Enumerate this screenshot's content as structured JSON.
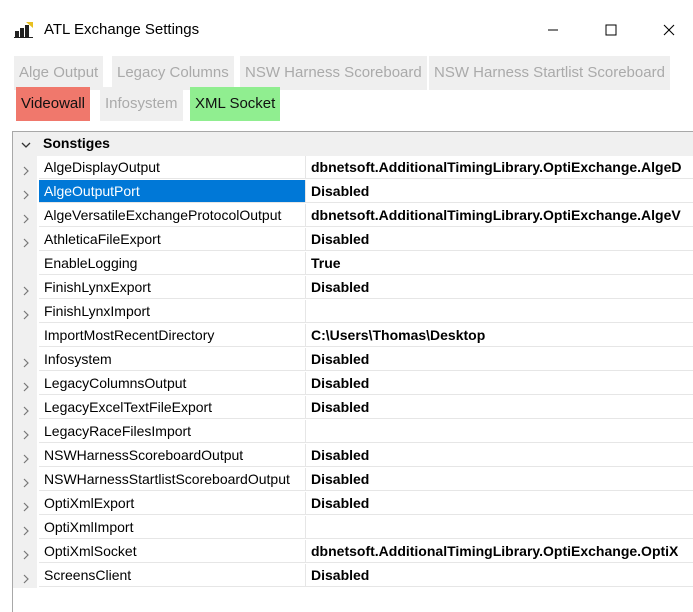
{
  "window": {
    "title": "ATL Exchange Settings",
    "controls": {
      "minimize_icon": "minimize-icon",
      "maximize_icon": "maximize-icon",
      "close_icon": "close-icon"
    }
  },
  "toolbar": {
    "buttons": [
      {
        "label": "Alge Output",
        "state": "disabled"
      },
      {
        "label": "Legacy Columns",
        "state": "disabled"
      },
      {
        "label": "NSW Harness Scoreboard",
        "state": "disabled"
      },
      {
        "label": "NSW Harness Startlist Scoreboard",
        "state": "disabled"
      },
      {
        "label": "Videowall",
        "state": "error",
        "color": "#f0786c"
      },
      {
        "label": "Infosystem",
        "state": "disabled"
      },
      {
        "label": "XML Socket",
        "state": "ok",
        "color": "#90ee90"
      }
    ]
  },
  "property_grid": {
    "category": "Sonstiges",
    "selected_color": "#0078d7",
    "rows": [
      {
        "name": "AlgeDisplayOutput",
        "value": "dbnetsoft.AdditionalTimingLibrary.OptiExchange.AlgeD",
        "expandable": true
      },
      {
        "name": "AlgeOutputPort",
        "value": "Disabled",
        "expandable": true,
        "selected": true
      },
      {
        "name": "AlgeVersatileExchangeProtocolOutput",
        "value": "dbnetsoft.AdditionalTimingLibrary.OptiExchange.AlgeV",
        "expandable": true
      },
      {
        "name": "AthleticaFileExport",
        "value": "Disabled",
        "expandable": true
      },
      {
        "name": "EnableLogging",
        "value": "True",
        "expandable": false
      },
      {
        "name": "FinishLynxExport",
        "value": "Disabled",
        "expandable": true
      },
      {
        "name": "FinishLynxImport",
        "value": "",
        "expandable": true
      },
      {
        "name": "ImportMostRecentDirectory",
        "value": "C:\\Users\\Thomas\\Desktop",
        "expandable": false
      },
      {
        "name": "Infosystem",
        "value": "Disabled",
        "expandable": true
      },
      {
        "name": "LegacyColumnsOutput",
        "value": "Disabled",
        "expandable": true
      },
      {
        "name": "LegacyExcelTextFileExport",
        "value": "Disabled",
        "expandable": true
      },
      {
        "name": "LegacyRaceFilesImport",
        "value": "",
        "expandable": true
      },
      {
        "name": "NSWHarnessScoreboardOutput",
        "value": "Disabled",
        "expandable": true
      },
      {
        "name": "NSWHarnessStartlistScoreboardOutput",
        "value": "Disabled",
        "expandable": true
      },
      {
        "name": "OptiXmlExport",
        "value": "Disabled",
        "expandable": true
      },
      {
        "name": "OptiXmlImport",
        "value": "",
        "expandable": true
      },
      {
        "name": "OptiXmlSocket",
        "value": "dbnetsoft.AdditionalTimingLibrary.OptiExchange.OptiX",
        "expandable": true
      },
      {
        "name": "ScreensClient",
        "value": "Disabled",
        "expandable": true
      }
    ]
  }
}
